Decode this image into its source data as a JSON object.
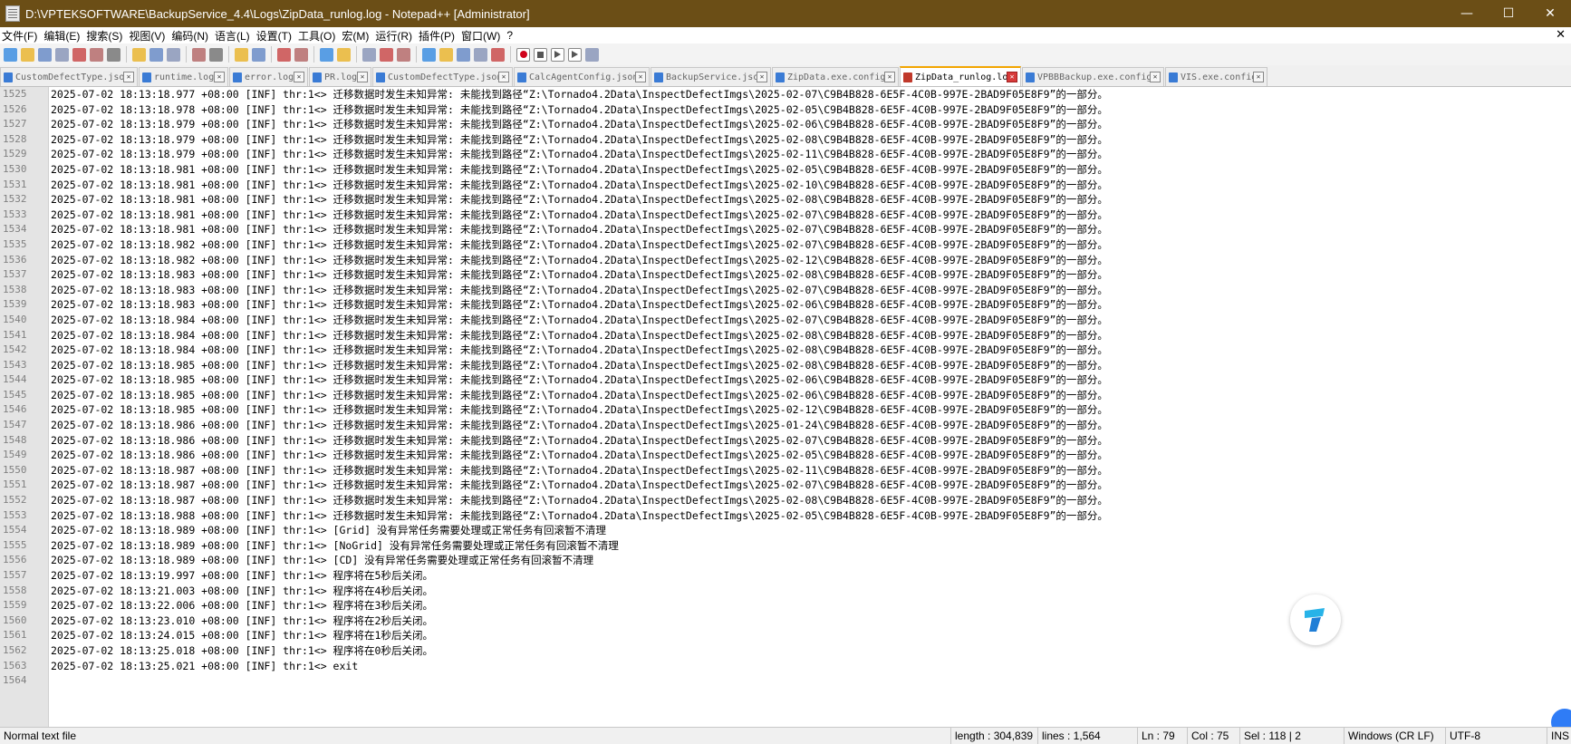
{
  "window": {
    "title": "D:\\VPTEKSOFTWARE\\BackupService_4.4\\Logs\\ZipData_runlog.log - Notepad++ [Administrator]",
    "minimize": "—",
    "maximize": "☐",
    "close": "✕"
  },
  "menu": {
    "items": [
      "文件(F)",
      "编辑(E)",
      "搜索(S)",
      "视图(V)",
      "编码(N)",
      "语言(L)",
      "设置(T)",
      "工具(O)",
      "宏(M)",
      "运行(R)",
      "插件(P)",
      "窗口(W)",
      "?"
    ],
    "close": "✕"
  },
  "toolbar": {
    "icons": [
      "new-file-icon",
      "open-file-icon",
      "save-icon",
      "save-all-icon",
      "close-icon",
      "close-all-icon",
      "print-icon",
      "sep",
      "cut-icon",
      "copy-icon",
      "paste-icon",
      "sep",
      "undo-icon",
      "redo-icon",
      "sep",
      "find-icon",
      "replace-icon",
      "sep",
      "zoom-in-icon",
      "zoom-out-icon",
      "sep",
      "sync-vertical-icon",
      "sync-horizontal-icon",
      "sep",
      "word-wrap-icon",
      "show-all-chars-icon",
      "indent-guide-icon",
      "sep",
      "user-lang-icon",
      "doc-map-icon",
      "function-list-icon",
      "folder-workspace-icon",
      "monitoring-icon",
      "sep",
      "record-macro-icon",
      "stop-record-icon",
      "play-macro-icon",
      "run-macro-multiple-icon",
      "save-macro-icon"
    ]
  },
  "tabs": [
    {
      "label": "CustomDefectType.json",
      "active": false
    },
    {
      "label": "runtime.log",
      "active": false
    },
    {
      "label": "error.log",
      "active": false
    },
    {
      "label": "PR.log",
      "active": false
    },
    {
      "label": "CustomDefectType.json",
      "active": false
    },
    {
      "label": "CalcAgentConfig.json",
      "active": false
    },
    {
      "label": "BackupService.json",
      "active": false
    },
    {
      "label": "ZipData.exe.config",
      "active": false
    },
    {
      "label": "ZipData_runlog.log",
      "active": true
    },
    {
      "label": "VPBBBackup.exe.config",
      "active": false
    },
    {
      "label": "VIS.exe.config",
      "active": false
    }
  ],
  "editor": {
    "line_numbers": [
      "1525",
      "1526",
      "1527",
      "1528",
      "1529",
      "1530",
      "1531",
      "1532",
      "1533",
      "1534",
      "1535",
      "1536",
      "1537",
      "1538",
      "1539",
      "1540",
      "1541",
      "1542",
      "1543",
      "1544",
      "1545",
      "1546",
      "1547",
      "1548",
      "1549",
      "1550",
      "1551",
      "1552",
      "1553",
      "1554",
      "1555",
      "1556",
      "1557",
      "1558",
      "1559",
      "1560",
      "1561",
      "1562",
      "1563",
      "1564"
    ],
    "lines": [
      "2025-07-02 18:13:18.977 +08:00 [INF] thr:1<> 迁移数据时发生未知异常: 未能找到路径“Z:\\Tornado4.2Data\\InspectDefectImgs\\2025-02-07\\C9B4B828-6E5F-4C0B-997E-2BAD9F05E8F9”的一部分。",
      "2025-07-02 18:13:18.978 +08:00 [INF] thr:1<> 迁移数据时发生未知异常: 未能找到路径“Z:\\Tornado4.2Data\\InspectDefectImgs\\2025-02-05\\C9B4B828-6E5F-4C0B-997E-2BAD9F05E8F9”的一部分。",
      "2025-07-02 18:13:18.979 +08:00 [INF] thr:1<> 迁移数据时发生未知异常: 未能找到路径“Z:\\Tornado4.2Data\\InspectDefectImgs\\2025-02-06\\C9B4B828-6E5F-4C0B-997E-2BAD9F05E8F9”的一部分。",
      "2025-07-02 18:13:18.979 +08:00 [INF] thr:1<> 迁移数据时发生未知异常: 未能找到路径“Z:\\Tornado4.2Data\\InspectDefectImgs\\2025-02-08\\C9B4B828-6E5F-4C0B-997E-2BAD9F05E8F9”的一部分。",
      "2025-07-02 18:13:18.979 +08:00 [INF] thr:1<> 迁移数据时发生未知异常: 未能找到路径“Z:\\Tornado4.2Data\\InspectDefectImgs\\2025-02-11\\C9B4B828-6E5F-4C0B-997E-2BAD9F05E8F9”的一部分。",
      "2025-07-02 18:13:18.981 +08:00 [INF] thr:1<> 迁移数据时发生未知异常: 未能找到路径“Z:\\Tornado4.2Data\\InspectDefectImgs\\2025-02-05\\C9B4B828-6E5F-4C0B-997E-2BAD9F05E8F9”的一部分。",
      "2025-07-02 18:13:18.981 +08:00 [INF] thr:1<> 迁移数据时发生未知异常: 未能找到路径“Z:\\Tornado4.2Data\\InspectDefectImgs\\2025-02-10\\C9B4B828-6E5F-4C0B-997E-2BAD9F05E8F9”的一部分。",
      "2025-07-02 18:13:18.981 +08:00 [INF] thr:1<> 迁移数据时发生未知异常: 未能找到路径“Z:\\Tornado4.2Data\\InspectDefectImgs\\2025-02-08\\C9B4B828-6E5F-4C0B-997E-2BAD9F05E8F9”的一部分。",
      "2025-07-02 18:13:18.981 +08:00 [INF] thr:1<> 迁移数据时发生未知异常: 未能找到路径“Z:\\Tornado4.2Data\\InspectDefectImgs\\2025-02-07\\C9B4B828-6E5F-4C0B-997E-2BAD9F05E8F9”的一部分。",
      "2025-07-02 18:13:18.981 +08:00 [INF] thr:1<> 迁移数据时发生未知异常: 未能找到路径“Z:\\Tornado4.2Data\\InspectDefectImgs\\2025-02-07\\C9B4B828-6E5F-4C0B-997E-2BAD9F05E8F9”的一部分。",
      "2025-07-02 18:13:18.982 +08:00 [INF] thr:1<> 迁移数据时发生未知异常: 未能找到路径“Z:\\Tornado4.2Data\\InspectDefectImgs\\2025-02-07\\C9B4B828-6E5F-4C0B-997E-2BAD9F05E8F9”的一部分。",
      "2025-07-02 18:13:18.982 +08:00 [INF] thr:1<> 迁移数据时发生未知异常: 未能找到路径“Z:\\Tornado4.2Data\\InspectDefectImgs\\2025-02-12\\C9B4B828-6E5F-4C0B-997E-2BAD9F05E8F9”的一部分。",
      "2025-07-02 18:13:18.983 +08:00 [INF] thr:1<> 迁移数据时发生未知异常: 未能找到路径“Z:\\Tornado4.2Data\\InspectDefectImgs\\2025-02-08\\C9B4B828-6E5F-4C0B-997E-2BAD9F05E8F9”的一部分。",
      "2025-07-02 18:13:18.983 +08:00 [INF] thr:1<> 迁移数据时发生未知异常: 未能找到路径“Z:\\Tornado4.2Data\\InspectDefectImgs\\2025-02-07\\C9B4B828-6E5F-4C0B-997E-2BAD9F05E8F9”的一部分。",
      "2025-07-02 18:13:18.983 +08:00 [INF] thr:1<> 迁移数据时发生未知异常: 未能找到路径“Z:\\Tornado4.2Data\\InspectDefectImgs\\2025-02-06\\C9B4B828-6E5F-4C0B-997E-2BAD9F05E8F9”的一部分。",
      "2025-07-02 18:13:18.984 +08:00 [INF] thr:1<> 迁移数据时发生未知异常: 未能找到路径“Z:\\Tornado4.2Data\\InspectDefectImgs\\2025-02-07\\C9B4B828-6E5F-4C0B-997E-2BAD9F05E8F9”的一部分。",
      "2025-07-02 18:13:18.984 +08:00 [INF] thr:1<> 迁移数据时发生未知异常: 未能找到路径“Z:\\Tornado4.2Data\\InspectDefectImgs\\2025-02-08\\C9B4B828-6E5F-4C0B-997E-2BAD9F05E8F9”的一部分。",
      "2025-07-02 18:13:18.984 +08:00 [INF] thr:1<> 迁移数据时发生未知异常: 未能找到路径“Z:\\Tornado4.2Data\\InspectDefectImgs\\2025-02-08\\C9B4B828-6E5F-4C0B-997E-2BAD9F05E8F9”的一部分。",
      "2025-07-02 18:13:18.985 +08:00 [INF] thr:1<> 迁移数据时发生未知异常: 未能找到路径“Z:\\Tornado4.2Data\\InspectDefectImgs\\2025-02-08\\C9B4B828-6E5F-4C0B-997E-2BAD9F05E8F9”的一部分。",
      "2025-07-02 18:13:18.985 +08:00 [INF] thr:1<> 迁移数据时发生未知异常: 未能找到路径“Z:\\Tornado4.2Data\\InspectDefectImgs\\2025-02-06\\C9B4B828-6E5F-4C0B-997E-2BAD9F05E8F9”的一部分。",
      "2025-07-02 18:13:18.985 +08:00 [INF] thr:1<> 迁移数据时发生未知异常: 未能找到路径“Z:\\Tornado4.2Data\\InspectDefectImgs\\2025-02-06\\C9B4B828-6E5F-4C0B-997E-2BAD9F05E8F9”的一部分。",
      "2025-07-02 18:13:18.985 +08:00 [INF] thr:1<> 迁移数据时发生未知异常: 未能找到路径“Z:\\Tornado4.2Data\\InspectDefectImgs\\2025-02-12\\C9B4B828-6E5F-4C0B-997E-2BAD9F05E8F9”的一部分。",
      "2025-07-02 18:13:18.986 +08:00 [INF] thr:1<> 迁移数据时发生未知异常: 未能找到路径“Z:\\Tornado4.2Data\\InspectDefectImgs\\2025-01-24\\C9B4B828-6E5F-4C0B-997E-2BAD9F05E8F9”的一部分。",
      "2025-07-02 18:13:18.986 +08:00 [INF] thr:1<> 迁移数据时发生未知异常: 未能找到路径“Z:\\Tornado4.2Data\\InspectDefectImgs\\2025-02-07\\C9B4B828-6E5F-4C0B-997E-2BAD9F05E8F9”的一部分。",
      "2025-07-02 18:13:18.986 +08:00 [INF] thr:1<> 迁移数据时发生未知异常: 未能找到路径“Z:\\Tornado4.2Data\\InspectDefectImgs\\2025-02-05\\C9B4B828-6E5F-4C0B-997E-2BAD9F05E8F9”的一部分。",
      "2025-07-02 18:13:18.987 +08:00 [INF] thr:1<> 迁移数据时发生未知异常: 未能找到路径“Z:\\Tornado4.2Data\\InspectDefectImgs\\2025-02-11\\C9B4B828-6E5F-4C0B-997E-2BAD9F05E8F9”的一部分。",
      "2025-07-02 18:13:18.987 +08:00 [INF] thr:1<> 迁移数据时发生未知异常: 未能找到路径“Z:\\Tornado4.2Data\\InspectDefectImgs\\2025-02-07\\C9B4B828-6E5F-4C0B-997E-2BAD9F05E8F9”的一部分。",
      "2025-07-02 18:13:18.987 +08:00 [INF] thr:1<> 迁移数据时发生未知异常: 未能找到路径“Z:\\Tornado4.2Data\\InspectDefectImgs\\2025-02-08\\C9B4B828-6E5F-4C0B-997E-2BAD9F05E8F9”的一部分。",
      "2025-07-02 18:13:18.988 +08:00 [INF] thr:1<> 迁移数据时发生未知异常: 未能找到路径“Z:\\Tornado4.2Data\\InspectDefectImgs\\2025-02-05\\C9B4B828-6E5F-4C0B-997E-2BAD9F05E8F9”的一部分。",
      "2025-07-02 18:13:18.989 +08:00 [INF] thr:1<> [Grid] 没有异常任务需要处理或正常任务有回滚暂不清理",
      "2025-07-02 18:13:18.989 +08:00 [INF] thr:1<> [NoGrid] 没有异常任务需要处理或正常任务有回滚暂不清理",
      "2025-07-02 18:13:18.989 +08:00 [INF] thr:1<> [CD] 没有异常任务需要处理或正常任务有回滚暂不清理",
      "2025-07-02 18:13:19.997 +08:00 [INF] thr:1<> 程序将在5秒后关闭。",
      "2025-07-02 18:13:21.003 +08:00 [INF] thr:1<> 程序将在4秒后关闭。",
      "2025-07-02 18:13:22.006 +08:00 [INF] thr:1<> 程序将在3秒后关闭。",
      "2025-07-02 18:13:23.010 +08:00 [INF] thr:1<> 程序将在2秒后关闭。",
      "2025-07-02 18:13:24.015 +08:00 [INF] thr:1<> 程序将在1秒后关闭。",
      "2025-07-02 18:13:25.018 +08:00 [INF] thr:1<> 程序将在0秒后关闭。",
      "2025-07-02 18:13:25.021 +08:00 [INF] thr:1<> exit",
      ""
    ]
  },
  "status": {
    "file_type": "Normal text file",
    "length": "length : 304,839",
    "lines": "lines : 1,564",
    "ln": "Ln : 79",
    "col": "Col : 75",
    "sel": "Sel : 118 | 2",
    "eol": "Windows (CR LF)",
    "encoding": "UTF-8",
    "ins": "INS"
  },
  "colors": {
    "titlebar": "#6b4e16",
    "active_tab_accent": "#f2a500",
    "gutter": "#e4e4e4"
  }
}
